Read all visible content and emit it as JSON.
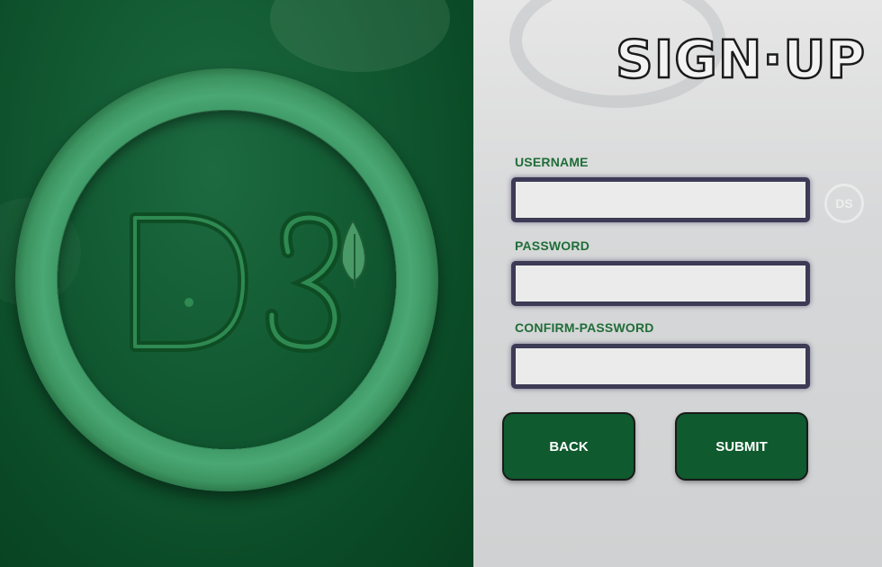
{
  "logo": {
    "text": "DS"
  },
  "header": {
    "title": "SIGN·UP"
  },
  "form": {
    "username": {
      "label": "USERNAME",
      "value": "",
      "placeholder": ""
    },
    "password": {
      "label": "PASSWORD",
      "value": "",
      "placeholder": ""
    },
    "confirm_password": {
      "label": "CONFIRM-PASSWORD",
      "value": "",
      "placeholder": ""
    }
  },
  "buttons": {
    "back": "BACK",
    "submit": "SUBMIT"
  },
  "colors": {
    "brand_green": "#0f5a2e",
    "label_green": "#1f6d38",
    "ring_green": "#3f9a67"
  },
  "icons": [
    "leaf-icon"
  ]
}
